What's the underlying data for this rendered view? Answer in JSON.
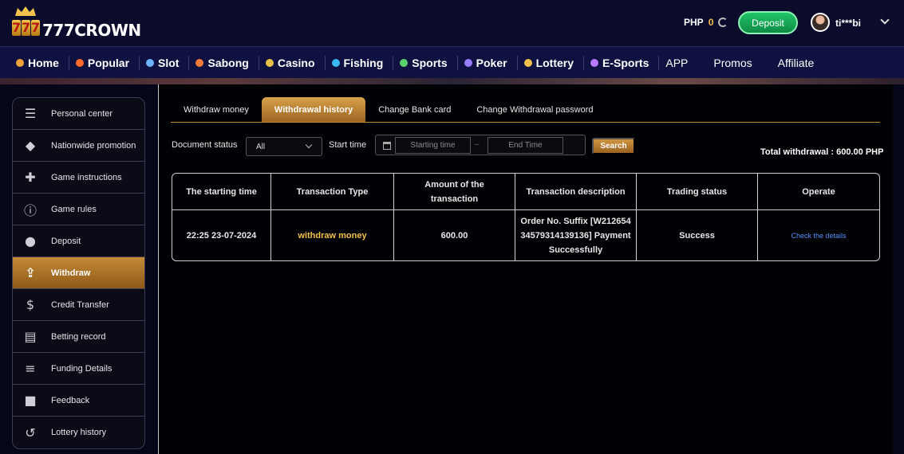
{
  "header": {
    "brand": "777CROWN",
    "currency": "PHP",
    "balance": "0",
    "deposit_label": "Deposit",
    "username": "ti***bi"
  },
  "nav": [
    {
      "label": "Home",
      "icon": "home-icon"
    },
    {
      "label": "Popular",
      "icon": "fire-icon"
    },
    {
      "label": "Slot",
      "icon": "slot-icon"
    },
    {
      "label": "Sabong",
      "icon": "rooster-icon"
    },
    {
      "label": "Casino",
      "icon": "dealer-icon"
    },
    {
      "label": "Fishing",
      "icon": "fish-icon"
    },
    {
      "label": "Sports",
      "icon": "soccer-ball-icon"
    },
    {
      "label": "Poker",
      "icon": "poker-icon"
    },
    {
      "label": "Lottery",
      "icon": "lottery-icon"
    },
    {
      "label": "E-Sports",
      "icon": "gamepad-icon"
    },
    {
      "label": "APP"
    },
    {
      "label": "Promos"
    },
    {
      "label": "Affiliate"
    }
  ],
  "sidebar": [
    {
      "label": "Personal center",
      "icon": "user-card-icon"
    },
    {
      "label": "Nationwide promotion",
      "icon": "diamond-icon"
    },
    {
      "label": "Game instructions",
      "icon": "gamepad-icon"
    },
    {
      "label": "Game rules",
      "icon": "info-icon"
    },
    {
      "label": "Deposit",
      "icon": "piggy-bank-icon"
    },
    {
      "label": "Withdraw",
      "icon": "withdraw-icon",
      "active": true
    },
    {
      "label": "Credit Transfer",
      "icon": "dollar-circle-icon"
    },
    {
      "label": "Betting record",
      "icon": "clipboard-icon"
    },
    {
      "label": "Funding Details",
      "icon": "coins-icon"
    },
    {
      "label": "Feedback",
      "icon": "chat-icon"
    },
    {
      "label": "Lottery history",
      "icon": "history-icon"
    }
  ],
  "tabs": [
    {
      "label": "Withdraw money"
    },
    {
      "label": "Withdrawal history",
      "active": true
    },
    {
      "label": "Change Bank card"
    },
    {
      "label": "Change Withdrawal password"
    }
  ],
  "filters": {
    "status_label": "Document status",
    "status_value": "All",
    "time_label": "Start time",
    "start_placeholder": "Starting time",
    "end_placeholder": "End Time",
    "search_label": "Search"
  },
  "total_withdrawal": "Total withdrawal : 600.00 PHP",
  "table": {
    "headers": [
      "The starting time",
      "Transaction Type",
      "Amount of the transaction",
      "Transaction description",
      "Trading status",
      "Operate"
    ],
    "rows": [
      {
        "time": "22:25 23-07-2024",
        "type": "withdraw money",
        "amount": "600.00",
        "description": "Order No. Suffix [W21265434579314139136] Payment Successfully",
        "status": "Success",
        "operate": "Check the details"
      }
    ]
  },
  "colors": {
    "accent": "#c48a37",
    "deposit_green": "#1fc46a",
    "link": "#5b8ff9",
    "balance": "#f2c14e"
  }
}
